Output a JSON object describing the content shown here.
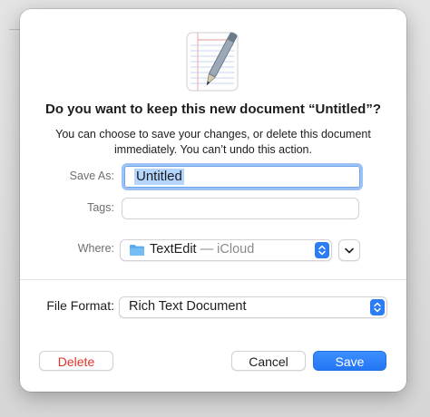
{
  "dialog": {
    "title": "Do you want to keep this new document “Untitled”?",
    "message": "You can choose to save your changes, or delete this document immediately. You can’t undo this action.",
    "app_icon": "textedit-icon"
  },
  "form": {
    "save_as_label": "Save As:",
    "save_as_value": "Untitled",
    "tags_label": "Tags:",
    "tags_value": "",
    "where_label": "Where:",
    "where_folder": "TextEdit",
    "where_location": "— iCloud",
    "file_format_label": "File Format:",
    "file_format_value": "Rich Text Document"
  },
  "buttons": {
    "delete": "Delete",
    "cancel": "Cancel",
    "save": "Save"
  },
  "colors": {
    "accent": "#2b7cf6",
    "destructive": "#e0342a",
    "selection": "#b4d5fe"
  }
}
